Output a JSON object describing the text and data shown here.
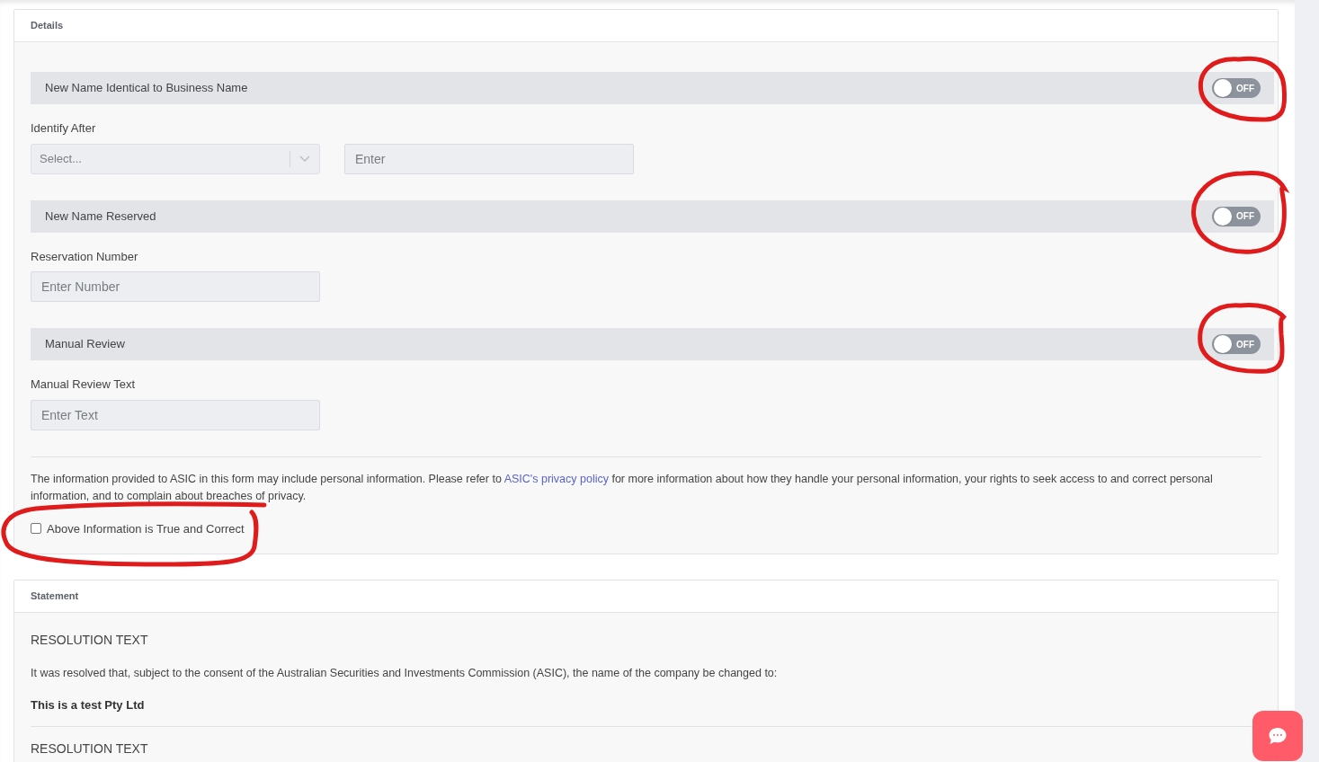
{
  "details": {
    "title": "Details",
    "sections": [
      {
        "toggle": {
          "label": "New Name Identical to Business Name",
          "on": false,
          "state_text": "OFF"
        },
        "field_label": "Identify After",
        "fields": [
          {
            "kind": "select",
            "placeholder": "Select..."
          },
          {
            "kind": "text",
            "placeholder": "Enter"
          }
        ]
      },
      {
        "toggle": {
          "label": "New Name Reserved",
          "on": false,
          "state_text": "OFF"
        },
        "field_label": "Reservation Number",
        "fields": [
          {
            "kind": "text",
            "placeholder": "Enter Number"
          }
        ]
      },
      {
        "toggle": {
          "label": "Manual Review",
          "on": false,
          "state_text": "OFF"
        },
        "field_label": "Manual Review Text",
        "fields": [
          {
            "kind": "text",
            "placeholder": "Enter Text"
          }
        ]
      }
    ],
    "notice": {
      "before": "The information provided to ASIC in this form may include personal information. Please refer to ",
      "link": "ASIC's privacy policy",
      "after": " for more information about how they handle your personal information, your rights to seek access to and correct personal information, and to complain about breaches of privacy."
    },
    "confirm": {
      "label": "Above Information is True and Correct",
      "checked": false
    }
  },
  "statement": {
    "title": "Statement",
    "blocks": [
      {
        "heading": "RESOLUTION TEXT",
        "text": "It was resolved that, subject to the consent of the Australian Securities and Investments Commission (ASIC), the name of the company be changed to:",
        "company": "This is a test Pty Ltd"
      },
      {
        "heading": "RESOLUTION TEXT"
      }
    ]
  }
}
